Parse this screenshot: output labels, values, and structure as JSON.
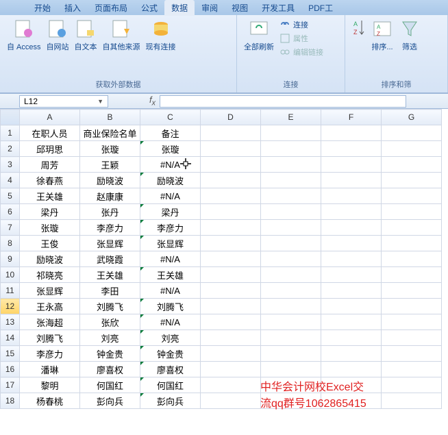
{
  "tabs": {
    "t0": "开始",
    "t1": "插入",
    "t2": "页面布局",
    "t3": "公式",
    "t4": "数据",
    "t5": "审阅",
    "t6": "视图",
    "t7": "开发工具",
    "t8": "PDF工"
  },
  "ribbon": {
    "g1": {
      "label": "获取外部数据",
      "i0": "自 Access",
      "i1": "自网站",
      "i2": "自文本",
      "i3": "自其他来源",
      "i4": "现有连接"
    },
    "g2": {
      "label": "连接",
      "i0": "全部刷新",
      "l0": "连接",
      "l1": "属性",
      "l2": "编辑链接"
    },
    "g3": {
      "label": "排序和筛",
      "i0": "排序...",
      "i1": "筛选"
    }
  },
  "namebox": "L12",
  "cols": {
    "A": "A",
    "B": "B",
    "C": "C",
    "D": "D",
    "E": "E",
    "F": "F",
    "G": "G"
  },
  "headers": {
    "c1": "在职人员",
    "c2": "商业保险名单",
    "c3": "备注"
  },
  "rows": [
    {
      "n": "1"
    },
    {
      "n": "2",
      "a": "邱玥思",
      "b": "张璇",
      "c": "张璇",
      "flag": true
    },
    {
      "n": "3",
      "a": "周芳",
      "b": "王颖",
      "c": "#N/A"
    },
    {
      "n": "4",
      "a": "徐春燕",
      "b": "励晓波",
      "c": "励晓波",
      "flag": true
    },
    {
      "n": "5",
      "a": "王关雄",
      "b": "赵康康",
      "c": "#N/A"
    },
    {
      "n": "6",
      "a": "梁丹",
      "b": "张丹",
      "c": "梁丹",
      "flag": true
    },
    {
      "n": "7",
      "a": "张璇",
      "b": "李彦力",
      "c": "李彦力",
      "flag": true
    },
    {
      "n": "8",
      "a": "王俊",
      "b": "张显辉",
      "c": "张显辉",
      "flag": true
    },
    {
      "n": "9",
      "a": "励晓波",
      "b": "武晓霞",
      "c": "#N/A"
    },
    {
      "n": "10",
      "a": "祁晓亮",
      "b": "王关雄",
      "c": "王关雄",
      "flag": true
    },
    {
      "n": "11",
      "a": "张显辉",
      "b": "李田",
      "c": "#N/A"
    },
    {
      "n": "12",
      "a": "王永高",
      "b": "刘腾飞",
      "c": "刘腾飞",
      "flag": true,
      "active": true
    },
    {
      "n": "13",
      "a": "张海超",
      "b": "张欣",
      "c": "#N/A",
      "flag": true
    },
    {
      "n": "14",
      "a": "刘腾飞",
      "b": "刘亮",
      "c": "刘亮",
      "flag": true
    },
    {
      "n": "15",
      "a": "李彦力",
      "b": "钟金贵",
      "c": "钟金贵",
      "flag": true
    },
    {
      "n": "16",
      "a": "潘琳",
      "b": "廖喜权",
      "c": "廖喜权",
      "flag": true
    },
    {
      "n": "17",
      "a": "黎明",
      "b": "何国红",
      "c": "何国红",
      "flag": true
    },
    {
      "n": "18",
      "a": "杨春桃",
      "b": "彭向兵",
      "c": "彭向兵",
      "flag": true
    }
  ],
  "overlay": {
    "l1": "中华会计网校Excel交",
    "l2": "流qq群号1062865415"
  }
}
